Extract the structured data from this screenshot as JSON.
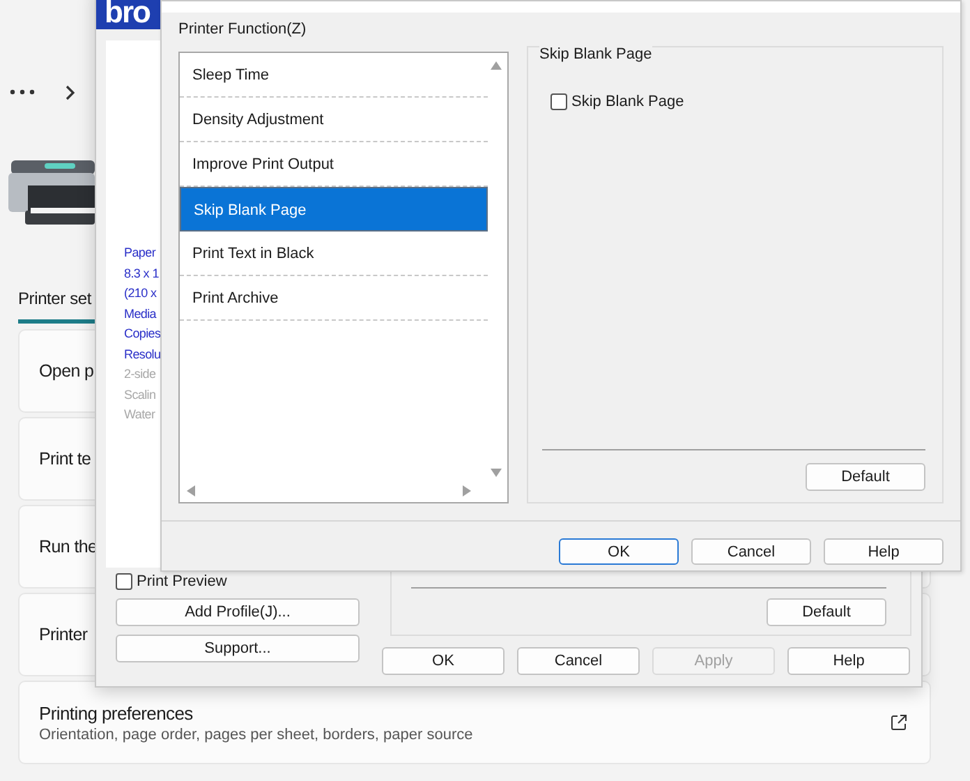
{
  "settings": {
    "tab": "Printer set",
    "cards": [
      {
        "title": "Open p"
      },
      {
        "title": "Print te"
      },
      {
        "title": "Run the"
      },
      {
        "title": "Printer"
      },
      {
        "title": "Printing preferences",
        "subtitle": "Orientation, page order, pages per sheet, borders, paper source",
        "external_link": true
      }
    ]
  },
  "preferences_dialog": {
    "logo": "bro",
    "summary": [
      {
        "text": "Paper",
        "disabled": false
      },
      {
        "text": "8.3 x 1",
        "disabled": false
      },
      {
        "text": "(210 x",
        "disabled": false
      },
      {
        "text": "Media",
        "disabled": false
      },
      {
        "text": "Copies",
        "disabled": false
      },
      {
        "text": "Resolu",
        "disabled": false
      },
      {
        "text": "2-side",
        "disabled": true
      },
      {
        "text": "Scalin",
        "disabled": true
      },
      {
        "text": "Water",
        "disabled": true
      }
    ],
    "print_preview": {
      "label": "Print Preview",
      "checked": false
    },
    "side_buttons": [
      "Add Profile(J)...",
      "Support..."
    ],
    "default_button": "Default",
    "buttons": [
      {
        "label": "OK",
        "disabled": false
      },
      {
        "label": "Cancel",
        "disabled": false
      },
      {
        "label": "Apply",
        "disabled": true
      },
      {
        "label": "Help",
        "disabled": false
      }
    ]
  },
  "function_dialog": {
    "list_label": "Printer Function(Z)",
    "functions": [
      {
        "label": "Sleep Time",
        "selected": false
      },
      {
        "label": "Density Adjustment",
        "selected": false
      },
      {
        "label": "Improve Print Output",
        "selected": false
      },
      {
        "label": "Skip Blank Page",
        "selected": true
      },
      {
        "label": "Print Text in Black",
        "selected": false
      },
      {
        "label": "Print Archive",
        "selected": false
      }
    ],
    "group_title": "Skip Blank Page",
    "option": {
      "label": "Skip Blank Page",
      "checked": false
    },
    "default_button": "Default",
    "buttons": [
      {
        "label": "OK",
        "default": true
      },
      {
        "label": "Cancel",
        "default": false
      },
      {
        "label": "Help",
        "default": false
      }
    ]
  }
}
